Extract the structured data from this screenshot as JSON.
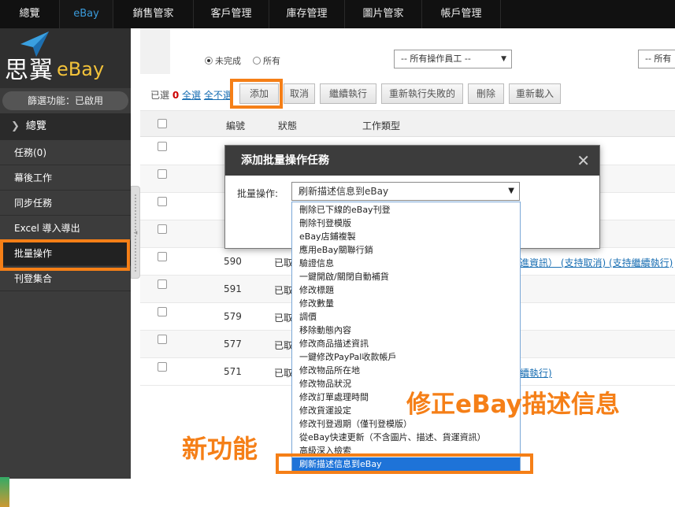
{
  "topnav": {
    "tabs": [
      {
        "label": "總覽",
        "active": false
      },
      {
        "label": "eBay",
        "active": true
      },
      {
        "label": "銷售管家",
        "active": false
      },
      {
        "label": "客戶管理",
        "active": false
      },
      {
        "label": "庫存管理",
        "active": false
      },
      {
        "label": "圖片管家",
        "active": false
      },
      {
        "label": "帳戶管理",
        "active": false
      }
    ]
  },
  "brand": {
    "name_cn": "思翼",
    "name_en": "eBay",
    "accent": "#f2c23a"
  },
  "sidebar": {
    "filter_status": "篩選功能：已啟用",
    "overview": "總覽",
    "items": [
      {
        "label": "任務(0)"
      },
      {
        "label": "幕後工作"
      },
      {
        "label": "同步任務"
      },
      {
        "label": "Excel 導入導出"
      },
      {
        "label": "批量操作",
        "active": true
      },
      {
        "label": "刊登集合"
      }
    ]
  },
  "filters": {
    "radio_incomplete": "未完成",
    "radio_all": "所有",
    "operator_select": "-- 所有操作員工 --",
    "second_select": "-- 所有"
  },
  "toolbar": {
    "selected_prefix": "已選",
    "selected_count": "0",
    "select_all": "全選",
    "select_none": "全不選",
    "buttons": [
      "添加",
      "取消",
      "繼續執行",
      "重新執行失敗的",
      "刪除",
      "重新載入"
    ]
  },
  "table": {
    "headers": [
      "編號",
      "狀態",
      "工作類型"
    ],
    "rows": [
      {
        "id": "",
        "status": "",
        "link": ""
      },
      {
        "id": "",
        "status": "",
        "link": ""
      },
      {
        "id": "",
        "status": "",
        "link": ""
      },
      {
        "id": "",
        "status": "",
        "link": ""
      },
      {
        "id": "590",
        "status": "已取",
        "link": "改進資訊） (支持取消) (支持繼續執行)"
      },
      {
        "id": "591",
        "status": "已取",
        "link": ""
      },
      {
        "id": "579",
        "status": "已取",
        "link": ""
      },
      {
        "id": "577",
        "status": "已取",
        "link": ""
      },
      {
        "id": "571",
        "status": "已取",
        "link": "繼續執行)"
      }
    ]
  },
  "modal": {
    "title": "添加批量操作任務",
    "label": "批量操作:",
    "selected_value": "刷新描述信息到eBay",
    "options": [
      "刪除已下線的eBay刊登",
      "刪除刊登模版",
      "eBay店鋪複製",
      "應用eBay關聯行銷",
      "驗證信息",
      "一鍵開啟/關閉自動補貨",
      "修改標題",
      "修改數量",
      "調價",
      "移除動態內容",
      "修改商品描述資訊",
      "一鍵修改PayPal收款帳戶",
      "修改物品所在地",
      "修改物品狀況",
      "修改訂單處理時間",
      "修改貨運設定",
      "修改刊登週期（僅刊登模版）",
      "從eBay快速更新（不含圖片、描述、貨運資訊）",
      "高級深入檢索",
      "刷新描述信息到eBay"
    ],
    "highlighted_index": 19
  },
  "annotations": {
    "fix_label": "修正eBay描述信息",
    "new_feature": "新功能",
    "color": "#f57f17"
  }
}
